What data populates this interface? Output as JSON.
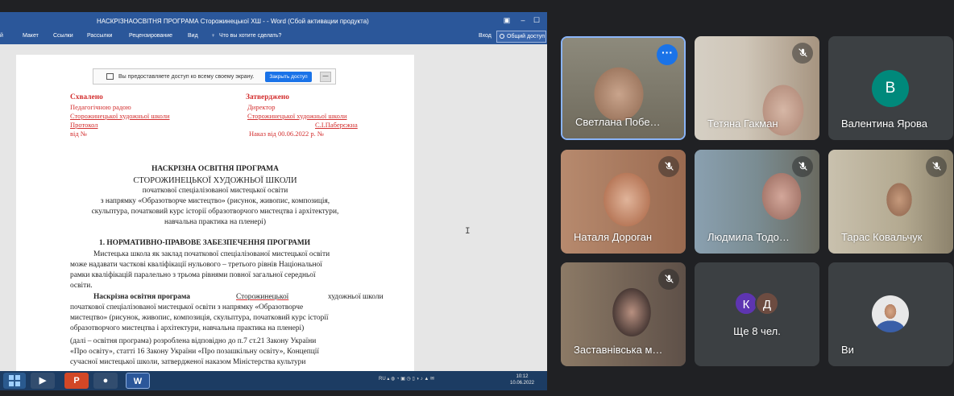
{
  "word": {
    "title": "НАСКРІЗНАОСВІТНЯ ПРОГРАМА Сторожинецької ХШ - - Word (Сбой активации продукта)",
    "ribbon": [
      "Макет",
      "Ссылки",
      "Рассылки",
      "Рецензирование",
      "Вид"
    ],
    "ribbon_first_partial": "й",
    "tell_me": "Что вы хотите сделать?",
    "signin": "Вход",
    "share": "Общий доступ",
    "window_controls": [
      "▣",
      "–",
      "☐"
    ]
  },
  "share_bar": {
    "message": "Вы предоставляете доступ ко всему своему экрану.",
    "stop_label": "Закрыть доступ",
    "hide_label": "—"
  },
  "document": {
    "left_block": {
      "heading": "Схвалено",
      "line1": "Педагогічною радою",
      "line2": "Сторожинецької художньої школи",
      "line3": "Протокол",
      "line4": "від              №"
    },
    "right_block": {
      "heading": "Затверджено",
      "line1": "Директор",
      "line2": "Сторожинецької художньої школи",
      "line3": "С.І.Паберєжна",
      "line4": "Наказ від 00.06.2022 р. №"
    },
    "title_lines": [
      "НАСКРІЗНА ОСВІТНЯ ПРОГРАМА",
      "СТОРОЖИНЕЦЬКОЇ ХУДОЖНЬОЇ ШКОЛИ",
      "початкової спеціалізованої мистецької освіти",
      "з напрямку «Образотворче мистецтво» (рисунок, живопис, композиція,",
      "скульптура, початковий курс історії образотворчого мистецтва і архітектури,",
      "навчальна практика на пленері)"
    ],
    "section_heading": "1. НОРМАТИВНО-ПРАВОВЕ ЗАБЕЗПЕЧЕННЯ ПРОГРАМИ",
    "para1": [
      "Мистецька школа як заклад початкової спеціалізованої мистецької освіти",
      "може надавати часткові кваліфікації нульового – третього рівнів Національної",
      "рамки кваліфікацій паралельно з трьома рівнями повної загальної середньої",
      "освіти."
    ],
    "para2_bold": "Наскрізна освітня програма",
    "para2_underlined": "Сторожинецької",
    "para2_rest_first": "художньої школи",
    "para2": [
      "початкової спеціалізованої мистецької освіти з напрямку «Образотворче",
      "мистецтво» (рисунок, живопис, композиція, скульптура, початковий курс історії",
      "образотворчого мистецтва і архітектури, навчальна практика на пленері)",
      "(далі – освітня програма) розроблена відповідно до п.7 ст.21 Закону України",
      "«Про освіту», статті 16 Закону України «Про позашкільну освіту», Концепції",
      "сучасної мистецької школи, затвердженої наказом Міністерства культури"
    ]
  },
  "taskbar": {
    "apps": [
      "P",
      "W"
    ],
    "tray_lang": "RU",
    "clock_time": "10:12",
    "clock_date": "10.06.2022"
  },
  "participants": [
    {
      "name": "Светлана Побе…",
      "status": "more",
      "tint": "#a98a78"
    },
    {
      "name": "Тетяна Гакман",
      "status": "muted",
      "tint": "#b6a49a"
    },
    {
      "name": "Валентина Ярова",
      "status": "none",
      "initial": "В",
      "avatar_color": "#00897b"
    },
    {
      "name": "Наталя Дороган",
      "status": "muted",
      "tint": "#b07a60"
    },
    {
      "name": "Людмила Тодо…",
      "status": "muted",
      "tint": "#8b8a86"
    },
    {
      "name": "Тарас Ковальчук",
      "status": "muted",
      "tint": "#9b9181"
    },
    {
      "name": "Заставнівська м…",
      "status": "muted",
      "tint": "#6e5f57"
    },
    {
      "name": "Ще 8 чел.",
      "status": "none",
      "initials": [
        "К",
        "Д"
      ],
      "avatar_colors": [
        "#5e35b1",
        "#6d4c41"
      ]
    },
    {
      "name": "Ви",
      "status": "none"
    }
  ],
  "colors": {
    "meet_background": "#202124",
    "tile": "#3c4043",
    "word_blue": "#2b579a",
    "accent": "#1a73e8"
  }
}
